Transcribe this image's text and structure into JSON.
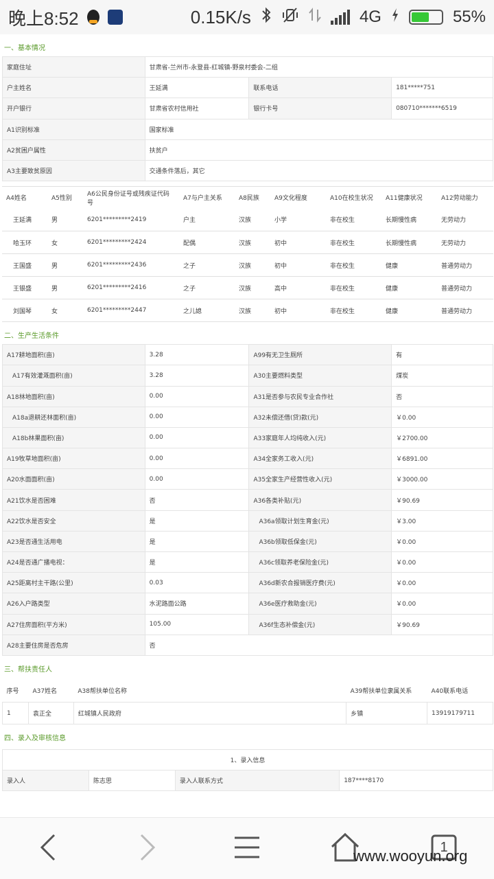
{
  "status_bar": {
    "time": "晚上8:52",
    "speed": "0.15K/s",
    "network": "4G",
    "battery": "55%",
    "battery_level": 0.55,
    "icons": [
      "qq-icon",
      "document-app-icon",
      "bluetooth-icon",
      "vibrate-off-icon",
      "data-transfer-icon",
      "signal-icon",
      "charging-icon",
      "battery-icon"
    ]
  },
  "section1": {
    "title": "一、基本情况",
    "rows": [
      {
        "l1": "家庭住址",
        "v1": "甘肃省-兰州市-永登县-红城镇-野泉村委会-二组"
      },
      {
        "l1": "户主姓名",
        "v1": "王延满",
        "l2": "联系电话",
        "v2": "181*****751"
      },
      {
        "l1": "开户银行",
        "v1": "甘肃省农村信用社",
        "l2": "银行卡号",
        "v2": "080710*******6519"
      },
      {
        "l1": "A1识别标准",
        "v1": "国家标准"
      },
      {
        "l1": "A2贫困户属性",
        "v1": "扶贫户"
      },
      {
        "l1": "A3主要致贫原因",
        "v1": "交通条件落后，其它"
      }
    ]
  },
  "members": {
    "headers": [
      "A4姓名",
      "A5性别",
      "A6公民身份证号或残疾证代码号",
      "A7与户主关系",
      "A8民族",
      "A9文化程度",
      "A10在校生状况",
      "A11健康状况",
      "A12劳动能力"
    ],
    "rows": [
      [
        "王延满",
        "男",
        "6201*********2419",
        "户主",
        "汉族",
        "小学",
        "非在校生",
        "长期慢性病",
        "无劳动力"
      ],
      [
        "哈玉环",
        "女",
        "6201*********2424",
        "配偶",
        "汉族",
        "初中",
        "非在校生",
        "长期慢性病",
        "无劳动力"
      ],
      [
        "王国盛",
        "男",
        "6201*********2436",
        "之子",
        "汉族",
        "初中",
        "非在校生",
        "健康",
        "普通劳动力"
      ],
      [
        "王银盛",
        "男",
        "6201*********2416",
        "之子",
        "汉族",
        "高中",
        "非在校生",
        "健康",
        "普通劳动力"
      ],
      [
        "刘国琴",
        "女",
        "6201*********2447",
        "之儿媳",
        "汉族",
        "初中",
        "非在校生",
        "健康",
        "普通劳动力"
      ]
    ]
  },
  "section2": {
    "title": "二、生产生活条件",
    "rows": [
      {
        "l1": "A17耕地面积(亩)",
        "v1": "3.28",
        "l2": "A99有无卫生厕所",
        "v2": "有"
      },
      {
        "l1": "A17有效灌溉面积(亩)",
        "v1": "3.28",
        "l2": "A30主要燃料类型",
        "v2": "煤炭",
        "sub1": true
      },
      {
        "l1": "A18林地面积(亩)",
        "v1": "0.00",
        "l2": "A31是否参与农民专业合作社",
        "v2": "否"
      },
      {
        "l1": "A18a退耕还林面积(亩)",
        "v1": "0.00",
        "l2": "A32未偿还借(贷)款(元)",
        "v2": "￥0.00",
        "sub1": true
      },
      {
        "l1": "A18b林果面积(亩)",
        "v1": "0.00",
        "l2": "A33家庭年人均纯收入(元)",
        "v2": "￥2700.00",
        "sub1": true
      },
      {
        "l1": "A19牧草地面积(亩)",
        "v1": "0.00",
        "l2": "A34全家务工收入(元)",
        "v2": "￥6891.00"
      },
      {
        "l1": "A20水面面积(亩)",
        "v1": "0.00",
        "l2": "A35全家生产经营性收入(元)",
        "v2": "￥3000.00"
      },
      {
        "l1": "A21饮水是否困难",
        "v1": "否",
        "l2": "A36各类补贴(元)",
        "v2": "￥90.69"
      },
      {
        "l1": "A22饮水是否安全",
        "v1": "是",
        "l2": "A36a领取计划生育金(元)",
        "v2": "￥3.00",
        "sub2": true
      },
      {
        "l1": "A23是否通生活用电",
        "v1": "是",
        "l2": "A36b领取低保金(元)",
        "v2": "￥0.00",
        "sub2": true
      },
      {
        "l1": "A24是否通广播电视：",
        "v1": "是",
        "l2": "A36c领取养老保险金(元)",
        "v2": "￥0.00",
        "sub2": true
      },
      {
        "l1": "A25距离村主干路(公里)",
        "v1": "0.03",
        "l2": "A36d新农合报销医疗费(元)",
        "v2": "￥0.00",
        "sub2": true
      },
      {
        "l1": "A26入户路类型",
        "v1": "水泥路面公路",
        "l2": "A36e医疗救助金(元)",
        "v2": "￥0.00",
        "sub2": true
      },
      {
        "l1": "A27住房面积(平方米)",
        "v1": "105.00",
        "l2": "A36f生态补偿金(元)",
        "v2": "￥90.69",
        "sub2": true
      },
      {
        "l1": "A28主要住房是否危房",
        "v1": "否"
      }
    ]
  },
  "section3": {
    "title": "三、帮扶责任人",
    "headers": [
      "序号",
      "A37姓名",
      "A38帮扶单位名称",
      "A39帮扶单位隶属关系",
      "A40联系电话"
    ],
    "rows": [
      [
        "1",
        "袁正全",
        "红城镇人民政府",
        "乡镇",
        "13919179711"
      ]
    ]
  },
  "section4": {
    "title": "四、录入及审核信息",
    "sub_title": "1、录入信息",
    "partial_row": {
      "l1": "录入人",
      "v1": "陈志思",
      "l2": "录入人联系方式",
      "v2": "187****8170"
    }
  },
  "navbar": {
    "tabs_count": "1",
    "watermark": "www.wooyun.org"
  }
}
